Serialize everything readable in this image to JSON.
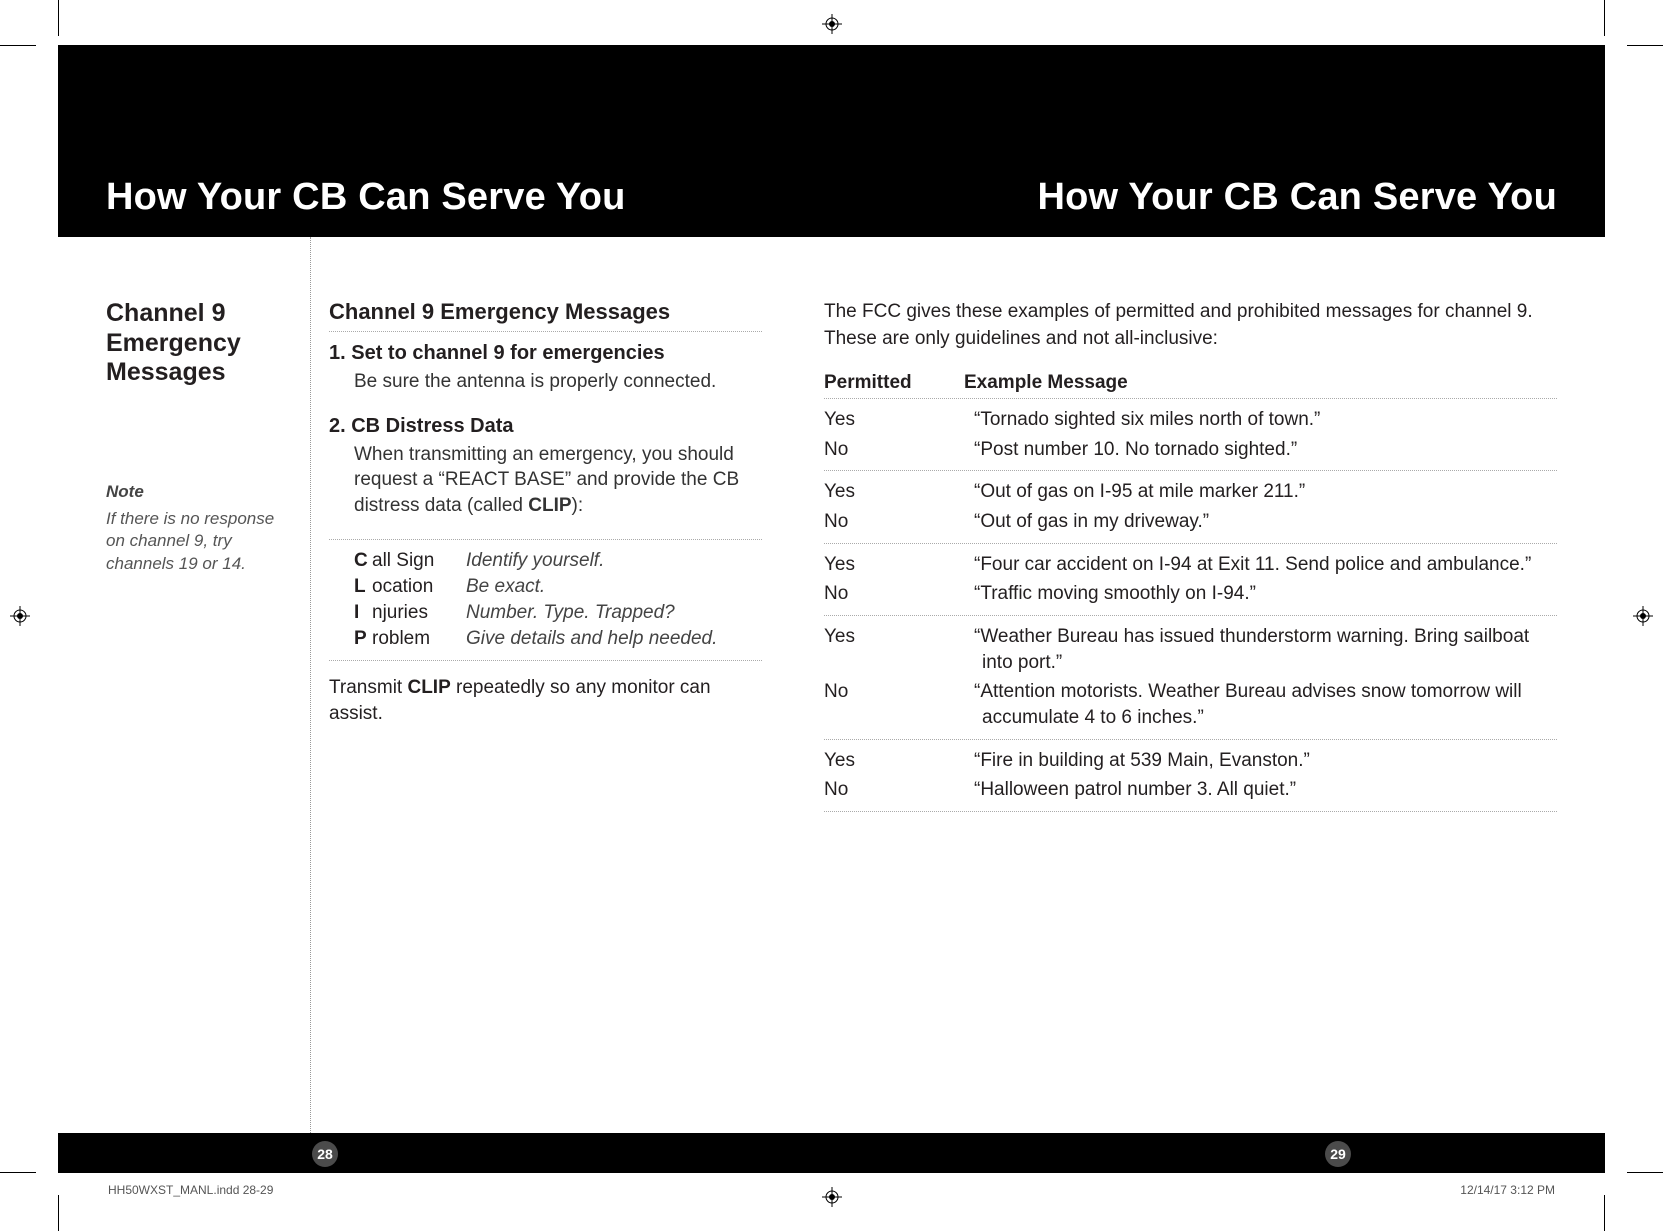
{
  "header": {
    "title_left": "How Your CB Can Serve You",
    "title_right": "How Your CB Can Serve You"
  },
  "sidebar": {
    "heading": "Channel 9 Emergency Messages",
    "note_label": "Note",
    "note_body": "If there is no response on channel 9, try channels 19 or 14."
  },
  "main_left": {
    "section_heading": "Channel 9 Emergency Messages",
    "steps": [
      {
        "title": "1.  Set to channel 9 for emergencies",
        "body": "Be sure the antenna is properly connected."
      },
      {
        "title": "2.  CB Distress Data",
        "body_pre": "When transmitting an emergency, you should request a “REACT BASE” and provide the CB distress data (called ",
        "body_bold": "CLIP",
        "body_post": "):"
      }
    ],
    "clip": [
      {
        "letter": "C",
        "word": "all Sign",
        "desc": "Identify yourself."
      },
      {
        "letter": "L",
        "word": "ocation",
        "desc": "Be exact."
      },
      {
        "letter": "I",
        "word": "njuries",
        "desc": "Number. Type. Trapped?"
      },
      {
        "letter": "P",
        "word": "roblem",
        "desc": "Give details and help needed."
      }
    ],
    "transmit_pre": "Transmit ",
    "transmit_bold": "CLIP",
    "transmit_post": " repeatedly so any monitor can assist."
  },
  "main_right": {
    "intro": "The FCC gives these examples of permitted and prohibited messages for channel 9.  These are only guidelines and not all-inclusive:",
    "head_c1": "Permitted",
    "head_c2": "Example Message",
    "groups": [
      [
        {
          "p": "Yes",
          "m": "“Tornado sighted six miles north of town.”"
        },
        {
          "p": "No",
          "m": "“Post number 10. No tornado sighted.”"
        }
      ],
      [
        {
          "p": "Yes",
          "m": "“Out of gas on I-95 at mile marker 211.”"
        },
        {
          "p": "No",
          "m": "“Out of gas in my driveway.”"
        }
      ],
      [
        {
          "p": "Yes",
          "m": "“Four car accident on I-94 at Exit 11.  Send police and ambulance.”"
        },
        {
          "p": "No",
          "m": "“Traffic moving smoothly on I-94.”"
        }
      ],
      [
        {
          "p": "Yes",
          "m": "“Weather Bureau has issued thunderstorm warning. Bring sailboat into port.”"
        },
        {
          "p": "No",
          "m": "“Attention motorists. Weather Bureau advises snow tomorrow will accumulate 4 to 6 inches.”"
        }
      ],
      [
        {
          "p": "Yes",
          "m": "“Fire in building at 539 Main, Evanston.”"
        },
        {
          "p": "No",
          "m": "“Halloween patrol number 3. All quiet.”"
        }
      ]
    ]
  },
  "footer": {
    "page_left": "28",
    "page_right": "29",
    "imprint_file": "HH50WXST_MANL.indd   28-29",
    "imprint_date": "12/14/17   3:12 PM"
  }
}
